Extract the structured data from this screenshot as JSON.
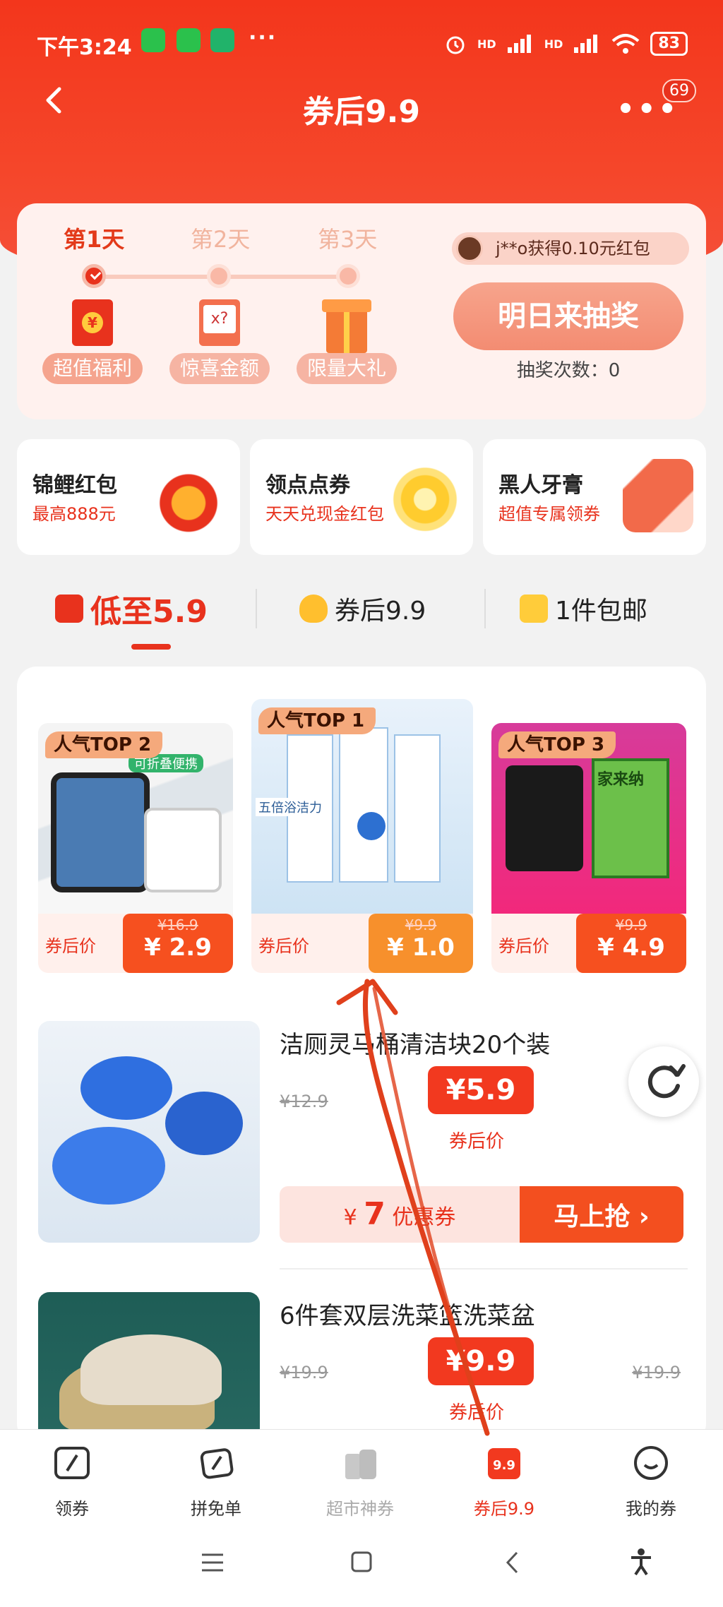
{
  "status_bar": {
    "time": "下午3:24",
    "dots": "···",
    "signal_1": "HD",
    "signal_2": "HD",
    "battery": "83"
  },
  "nav": {
    "title": "券后9.9",
    "more_badge": "69"
  },
  "lottery": {
    "days": [
      "第1天",
      "第2天",
      "第3天"
    ],
    "rewards": [
      "超值福利",
      "惊喜金额",
      "限量大礼"
    ],
    "mystery_mark": "x?",
    "winner_text": "j**o获得0.10元红包",
    "draw_button": "明日来抽奖",
    "draw_count": "抽奖次数：0"
  },
  "promos": [
    {
      "title": "锦鲤红包",
      "subtitle": "最高888元"
    },
    {
      "title": "领点点券",
      "subtitle": "天天兑现金红包"
    },
    {
      "title": "黑人牙膏",
      "subtitle": "超值专属领券"
    }
  ],
  "tabs": [
    {
      "label": "低至5.9"
    },
    {
      "label": "券后9.9"
    },
    {
      "label": "1件包邮"
    }
  ],
  "top_products": [
    {
      "badge": "人气TOP 2",
      "note": "可折叠便携",
      "price_label": "券后价",
      "original": "¥16.9",
      "price": "¥ 2.9"
    },
    {
      "badge": "人气TOP 1",
      "note": "五倍浴洁力",
      "price_label": "券后价",
      "original": "¥9.9",
      "price": "¥ 1.0"
    },
    {
      "badge": "人气TOP 3",
      "note": "家来纳",
      "price_label": "券后价",
      "original": "¥9.9",
      "price": "¥ 4.9"
    }
  ],
  "items": [
    {
      "title": "洁厕灵马桶清洁块20个装",
      "original": "¥12.9",
      "price": "¥5.9",
      "price_label": "券后价",
      "coupon_currency": "¥",
      "coupon_amount": "7",
      "coupon_label": "优惠券",
      "button": "马上抢 ›"
    },
    {
      "title": "6件套双层洗菜篮洗菜盆",
      "original": "¥19.9",
      "original_right": "¥19.9",
      "price": "¥9.9",
      "price_label": "券后价"
    }
  ],
  "bottom_nav": [
    {
      "label": "领券"
    },
    {
      "label": "拼免单"
    },
    {
      "label": "超市神券"
    },
    {
      "label": "券后9.9"
    },
    {
      "label": "我的券"
    }
  ],
  "colors": {
    "primary": "#e8321d",
    "header": "#f3361c",
    "annotation_arrow": "#e0401c"
  }
}
